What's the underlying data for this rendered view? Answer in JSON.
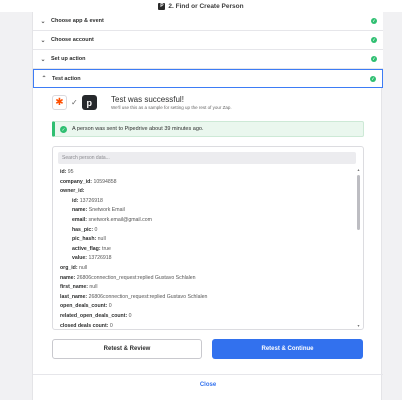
{
  "window": {
    "title": "2. Find or Create Person",
    "app_logo_letter": "P"
  },
  "steps": [
    {
      "label": "Choose app & event",
      "status": "complete"
    },
    {
      "label": "Choose account",
      "status": "complete"
    },
    {
      "label": "Set up action",
      "status": "complete"
    },
    {
      "label": "Test action",
      "status": "complete",
      "expanded": true
    }
  ],
  "test_result": {
    "title": "Test was successful!",
    "subtitle": "We'll use this as a sample for setting up the rest of your Zap.",
    "app_letter": "p",
    "banner": "A person was sent to Pipedrive about 39 minutes ago."
  },
  "search": {
    "placeholder": "Search person data..."
  },
  "fields": [
    {
      "key": "id:",
      "value": "95",
      "indent": 1
    },
    {
      "key": "company_id:",
      "value": "10594858",
      "indent": 1
    },
    {
      "key": "owner_id:",
      "value": "",
      "indent": 1
    },
    {
      "key": "id:",
      "value": "13726918",
      "indent": 2
    },
    {
      "key": "name:",
      "value": "Snetwork Email",
      "indent": 2
    },
    {
      "key": "email:",
      "value": "snetwork.email@gmail.com",
      "indent": 2
    },
    {
      "key": "has_pic:",
      "value": "0",
      "indent": 2
    },
    {
      "key": "pic_hash:",
      "value": "null",
      "indent": 2
    },
    {
      "key": "active_flag:",
      "value": "true",
      "indent": 2
    },
    {
      "key": "value:",
      "value": "13726918",
      "indent": 2
    },
    {
      "key": "org_id:",
      "value": "null",
      "indent": 1
    },
    {
      "key": "name:",
      "value": "26806connection_request:replied Gustavo Schlalen",
      "indent": 1
    },
    {
      "key": "first_name:",
      "value": "null",
      "indent": 1
    },
    {
      "key": "last_name:",
      "value": "26806connection_request:replied Gustavo Schlalen",
      "indent": 1
    },
    {
      "key": "open_deals_count:",
      "value": "0",
      "indent": 1
    },
    {
      "key": "related_open_deals_count:",
      "value": "0",
      "indent": 1
    },
    {
      "key": "closed deals count:",
      "value": "0",
      "indent": 1
    }
  ],
  "buttons": {
    "retest_review": "Retest & Review",
    "retest_continue": "Retest & Continue",
    "close": "Close"
  },
  "colors": {
    "accent": "#3271ee",
    "success": "#2fbf71",
    "zapier_orange": "#ff4f00"
  },
  "icons": {
    "chevron_collapsed": "chevron-down-icon",
    "chevron_expanded": "chevron-up-icon",
    "step_check": "check-circle-icon",
    "zapier": "zapier-logo-icon",
    "pipedrive": "pipedrive-logo-icon"
  }
}
